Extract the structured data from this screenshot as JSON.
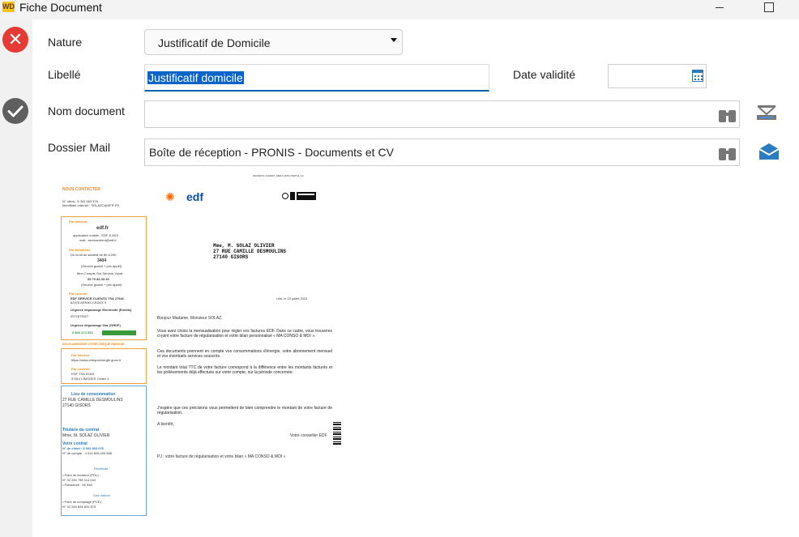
{
  "window": {
    "title": "Fiche Document",
    "app_icon": "WD"
  },
  "form": {
    "nature": {
      "label": "Nature",
      "value": "Justificatif de Domicile"
    },
    "libelle": {
      "label": "Libellé",
      "value": "Justificatif domicile"
    },
    "date_validite": {
      "label": "Date validité",
      "value": ""
    },
    "nom_document": {
      "label": "Nom document",
      "value": ""
    },
    "dossier_mail": {
      "label": "Dossier Mail",
      "value": "Boîte de réception - PRONIS - Documents et CV"
    }
  },
  "document": {
    "ref": "2023SP16_2122907_06010_NP0_PART11_10",
    "brand": "edf",
    "contact_title": "NOUS CONTACTER",
    "client_no": "N° client : 5 003 963 976",
    "ident": "Identifiant Internet : SOLAZO@SFR.FR",
    "internet": "Par Internet",
    "site": "edf.fr",
    "app": "application mobile : EDF & MOI",
    "mail": "mail : serviceclient@edf.fr",
    "phone": "Par téléphone",
    "phone_hours": "Du lundi au samedi de 8h à 20h",
    "phone_num": "3404",
    "phone_note": "(Service gratuit + prix appel)",
    "compte": "Mon Compte Sur Serveur Vocal",
    "compte_num": "09 70 83 33 33",
    "courrier": "Par courrier",
    "edf_service": "EDF SERVICE CLIENTS TSA 27941",
    "arras": "62978 ARRAS CEDEX 9",
    "urgence_elec": "Urgence dépannage Electricité (Enedis)",
    "urgence_elec_num": "0972675027",
    "urgence_gaz": "Urgence dépannage Gaz (GRDF)",
    "urgence_gaz_num": "0 800 473 333",
    "cheque_title": "NOUS ADRESSER VOTRE CHÈQUE ÉNERGIE",
    "cheque_internet": "Par Internet",
    "cheque_site": "https://www.chequeenergie.gouv.fr",
    "cheque_courrier": "Par courrier",
    "cheque_addr1": "EDF TSA 61481",
    "cheque_addr2": "97814 LIMOGES Cedex 1",
    "lieu_title": "Lieu de consommation",
    "lieu_addr1": "27 RUE CAMILLE DESMOULINS",
    "lieu_addr2": "27140 GISORS",
    "titulaire_title": "Titulaire du contrat",
    "titulaire": "Mme, M. SOLAZ OLIVIER",
    "contrat_title": "Votre contrat",
    "contrat_client": "N° de client : 5 003 963 976",
    "contrat_compte": "N° de compte : 4 014 828 839 588",
    "electricite": "Electricité",
    "gaz": "Gaz naturel",
    "pdl": "• Point de livraison (PDL) :",
    "pdl_num": "N° 02 284 798 114 044",
    "puissance": "• Puissance : 06 kVA",
    "pce": "• Point de comptage (PCE) :",
    "pce_num": "N° 02 284 834 831 879",
    "address_lines": [
      "Mme, M. SOLAZ OLIVIER",
      "27 RUE CAMILLE DESMOULINS",
      "27140 GISORS"
    ],
    "date_line": "Lille, le 10 juillet 2023",
    "greeting": "Bonjour Madame, Monsieur SOLAZ,",
    "p1": "Vous avez choisi la mensualisation pour régler vos factures EDF. Dans ce cadre, vous trouverez ci-joint votre facture de régularisation et votre bilan personnalisé « MA CONSO & MOI ».",
    "p2": "Ces documents prennent en compte vos consommations d'énergie, votre abonnement mensuel et vos éventuels services souscrits.",
    "p3": "Le montant total TTC de votre facture correspond à la différence entre les montants facturés et les prélèvements déjà effectués sur votre compte, sur la période concernée.",
    "p4": "J'espère que ces précisions vous permettent de bien comprendre le montant de votre facture de régularisation.",
    "signoff": "A bientôt,",
    "signature": "Votre conseiller EDF",
    "pj": "PJ : votre facture de régularisation et votre bilan « MA CONSO & MOI »"
  },
  "icons": [
    "close-icon",
    "check-icon",
    "calendar-icon",
    "binoculars-icon",
    "scanner-icon",
    "mail-icon"
  ],
  "colors": {
    "accent": "#0063b1",
    "danger": "#e63b35",
    "edf_orange": "#f08a0c",
    "edf_blue": "#0b4ea2"
  }
}
